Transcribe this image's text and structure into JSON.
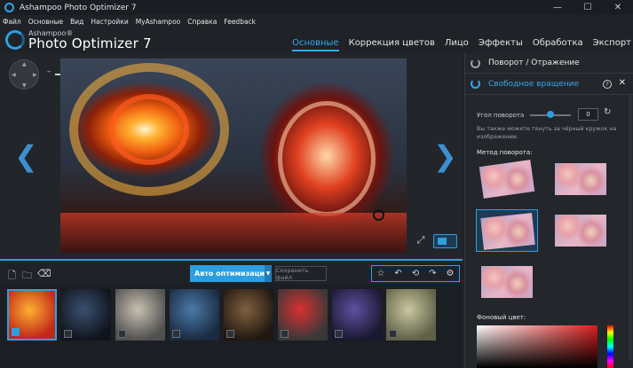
{
  "window": {
    "title": "Ashampoo Photo Optimizer 7"
  },
  "menu": [
    "Файл",
    "Основные",
    "Вид",
    "Настройки",
    "MyAshampoo",
    "Справка",
    "Feedback"
  ],
  "logo": {
    "line1": "Ashampoo®",
    "line2": "Photo Optimizer 7"
  },
  "tabs": [
    {
      "label": "Основные",
      "active": true
    },
    {
      "label": "Коррекция цветов",
      "active": false
    },
    {
      "label": "Лицо",
      "active": false
    },
    {
      "label": "Эффекты",
      "active": false
    },
    {
      "label": "Обработка",
      "active": false
    },
    {
      "label": "Экспорт",
      "active": false
    }
  ],
  "toolbar": {
    "auto_label": "Авто оптимизация",
    "save_label": "Сохранить файл"
  },
  "filmstrip": {
    "thumbs": [
      {
        "colors": [
          "#ffb030",
          "#c02818"
        ],
        "selected": true
      },
      {
        "colors": [
          "#3a5070",
          "#10141c"
        ],
        "selected": false
      },
      {
        "colors": [
          "#c8c0b0",
          "#505050"
        ],
        "selected": false
      },
      {
        "colors": [
          "#4a7aa8",
          "#1a2a40"
        ],
        "selected": false
      },
      {
        "colors": [
          "#806040",
          "#201810"
        ],
        "selected": false
      },
      {
        "colors": [
          "#d83030",
          "#383838"
        ],
        "selected": false
      },
      {
        "colors": [
          "#6050a0",
          "#1a1830"
        ],
        "selected": false
      },
      {
        "colors": [
          "#c8c8a0",
          "#606048"
        ],
        "selected": false
      }
    ]
  },
  "panel": {
    "rotate_flip": "Поворот / Отражение",
    "free_rotation": "Свободное вращение",
    "help": "?",
    "angle_label": "Угол поворота",
    "angle_value": "0",
    "hint": "Вы также можете тянуть за чёрный кружок на изображении.",
    "method_label": "Метод поворота:",
    "bg_label": "Фоновый цвет:",
    "methods": [
      {
        "selected": false
      },
      {
        "selected": false
      },
      {
        "selected": true
      },
      {
        "selected": false
      },
      {
        "selected": false
      }
    ]
  },
  "colors": {
    "accent": "#2d9fe0",
    "background": "#1f2328"
  }
}
